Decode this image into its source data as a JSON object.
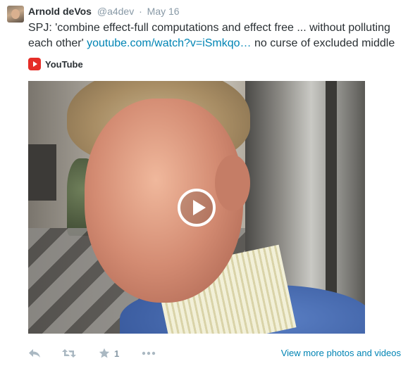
{
  "author": {
    "fullname": "Arnold deVos",
    "username": "@a4dev",
    "separator": "·",
    "timestamp": "May 16"
  },
  "tweet": {
    "text_before": "SPJ: 'combine effect-full computations and effect free ... without polluting each other' ",
    "link_text": "youtube.com/watch?v=iSmkqo…",
    "text_after": " no curse of excluded middle"
  },
  "card": {
    "source_label": "YouTube",
    "source_icon": "youtube-icon",
    "play_icon": "play-icon"
  },
  "actions": {
    "reply_icon": "reply-icon",
    "retweet_icon": "retweet-icon",
    "favorite_icon": "star-icon",
    "favorite_count": "1",
    "more_icon": "more-icon",
    "view_more_label": "View more photos and videos"
  },
  "colors": {
    "link": "#0084b4",
    "muted": "#8899a6",
    "youtube_red": "#e52d27"
  }
}
